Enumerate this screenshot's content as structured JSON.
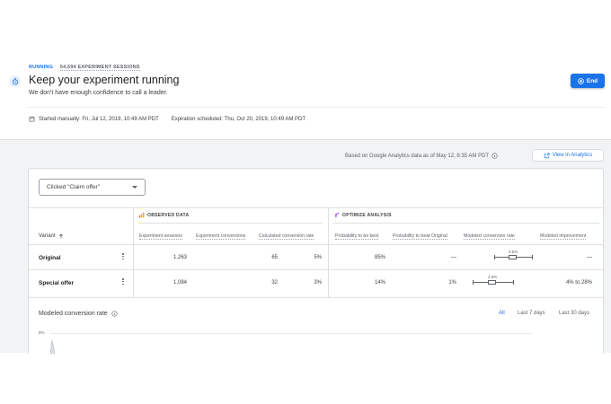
{
  "experiment": {
    "status": "RUNNING",
    "sessions": "54,594 EXPERIMENT SESSIONS",
    "title": "Keep your experiment running",
    "subtitle": "We don't have enough confidence to call a leader.",
    "end_label": "End",
    "started": "Started manually: Fri, Jul 12, 2019, 10:49 AM PDT",
    "expiration": "Expiration scheduled: Thu, Oct 20, 2019, 10:49 AM PDT"
  },
  "analytics": {
    "based_on": "Based on Google Analytics data as of May 12, 6:35 AM PDT",
    "view_label": "View in Analytics"
  },
  "objective": {
    "selected": "Clicked \"Claim offer\""
  },
  "table": {
    "variant_header": "Variant",
    "groups": {
      "observed": "OBSERVED DATA",
      "optimize": "OPTIMIZE ANALYSIS"
    },
    "columns": [
      "Experiment sessions",
      "Experiment conversions",
      "Calculated conversion rate",
      "Probability to be best",
      "Probability to beat Original",
      "Modeled conversion rate",
      "Modeled improvement"
    ],
    "rows": [
      {
        "name": "Original",
        "sessions": "1,263",
        "conversions": "65",
        "rate": "5%",
        "prob_best": "85%",
        "prob_beat": "—",
        "modeled_label": "4.5%",
        "modeled_value": 4.5,
        "improvement": "—"
      },
      {
        "name": "Special offer",
        "sessions": "1,084",
        "conversions": "32",
        "rate": "3%",
        "prob_best": "14%",
        "prob_beat": "1%",
        "modeled_label": "2.9%",
        "modeled_value": 2.9,
        "improvement": "4% to 28%"
      }
    ]
  },
  "modeled_chart": {
    "title": "Modeled conversion rate",
    "ranges": [
      "All",
      "Last 7 days",
      "Last 30 days"
    ],
    "active_range": "All",
    "y_tick": "8%"
  },
  "colors": {
    "accent": "#1a73e8",
    "analytics_orange": "#f9ab00",
    "optimize_purple": "#a142f4"
  },
  "icons": {
    "timer": "timer-icon",
    "end": "stop-circle-icon",
    "calendar": "calendar-icon",
    "info": "info-icon",
    "open": "open-in-new-icon",
    "sort": "arrow-up-icon",
    "more": "more-vert-icon"
  }
}
